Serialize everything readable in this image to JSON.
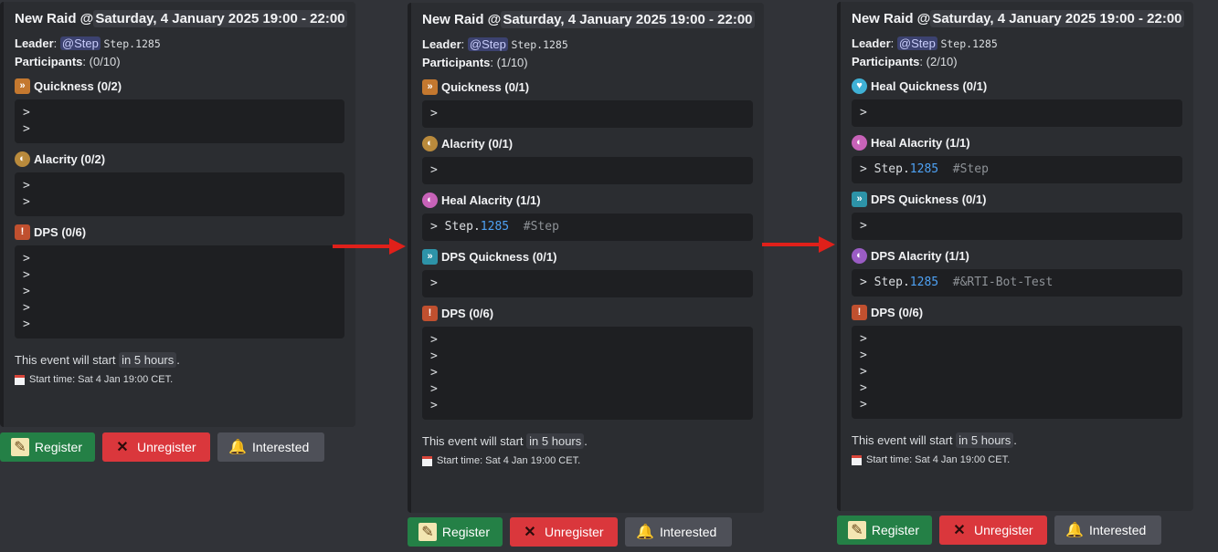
{
  "embeds": [
    {
      "title_prefix": "New Raid @",
      "title_date": "Saturday, 4 January 2025 19:00 - 22:00",
      "leader_label": "Leader",
      "leader_mention": "@Step",
      "leader_tag": "Step.1285",
      "participants_label": "Participants",
      "participants_count": "(0/10)",
      "roles": [
        {
          "icon": "quickness-icon",
          "label": "Quickness (0/2)",
          "entries": [
            ">",
            ">"
          ]
        },
        {
          "icon": "alacrity-icon",
          "label": "Alacrity (0/2)",
          "entries": [
            ">",
            ">"
          ]
        },
        {
          "icon": "dps-icon",
          "label": "DPS (0/6)",
          "entries": [
            ">",
            ">",
            ">",
            ">",
            ">"
          ]
        }
      ],
      "footer_text": "This event will start",
      "footer_relative": "in 5 hours",
      "start_time": "Start time: Sat 4 Jan 19:00 CET."
    },
    {
      "title_prefix": "New Raid @",
      "title_date": "Saturday, 4 January 2025 19:00 - 22:00",
      "leader_label": "Leader",
      "leader_mention": "@Step",
      "leader_tag": "Step.1285",
      "participants_label": "Participants",
      "participants_count": "(1/10)",
      "roles": [
        {
          "icon": "quickness-icon",
          "label": "Quickness (0/1)",
          "entries": [
            ">"
          ]
        },
        {
          "icon": "alacrity-icon",
          "label": "Alacrity (0/1)",
          "entries": [
            ">"
          ]
        },
        {
          "icon": "heal-alacrity-icon",
          "label": "Heal Alacrity (1/1)",
          "entries": [
            {
              "name": "Step.",
              "num": "1285",
              "channel": "#Step"
            }
          ]
        },
        {
          "icon": "dps-quickness-icon",
          "label": "DPS Quickness (0/1)",
          "entries": [
            ">"
          ]
        },
        {
          "icon": "dps-icon",
          "label": "DPS (0/6)",
          "entries": [
            ">",
            ">",
            ">",
            ">",
            ">"
          ]
        }
      ],
      "footer_text": "This event will start",
      "footer_relative": "in 5 hours",
      "start_time": "Start time: Sat 4 Jan 19:00 CET."
    },
    {
      "title_prefix": "New Raid @",
      "title_date": "Saturday, 4 January 2025 19:00 - 22:00",
      "leader_label": "Leader",
      "leader_mention": "@Step",
      "leader_tag": "Step.1285",
      "participants_label": "Participants",
      "participants_count": "(2/10)",
      "roles": [
        {
          "icon": "heal-quickness-icon",
          "label": "Heal Quickness (0/1)",
          "entries": [
            ">"
          ]
        },
        {
          "icon": "heal-alacrity-icon",
          "label": "Heal Alacrity (1/1)",
          "entries": [
            {
              "name": "Step.",
              "num": "1285",
              "channel": "#Step"
            }
          ]
        },
        {
          "icon": "dps-quickness-icon",
          "label": "DPS Quickness (0/1)",
          "entries": [
            ">"
          ]
        },
        {
          "icon": "dps-alacrity-icon",
          "label": "DPS Alacrity (1/1)",
          "entries": [
            {
              "name": "Step.",
              "num": "1285",
              "channel": "#&RTI-Bot-Test"
            }
          ]
        },
        {
          "icon": "dps-icon",
          "label": "DPS (0/6)",
          "entries": [
            ">",
            ">",
            ">",
            ">",
            ">"
          ]
        }
      ],
      "footer_text": "This event will start",
      "footer_relative": "in 5 hours",
      "start_time": "Start time: Sat 4 Jan 19:00 CET."
    }
  ],
  "buttons": {
    "register": "Register",
    "unregister": "Unregister",
    "interested": "Interested"
  },
  "colors": {
    "register": "#248046",
    "unregister": "#da373c",
    "interested": "#4e5058",
    "arrow": "#e0201a"
  }
}
